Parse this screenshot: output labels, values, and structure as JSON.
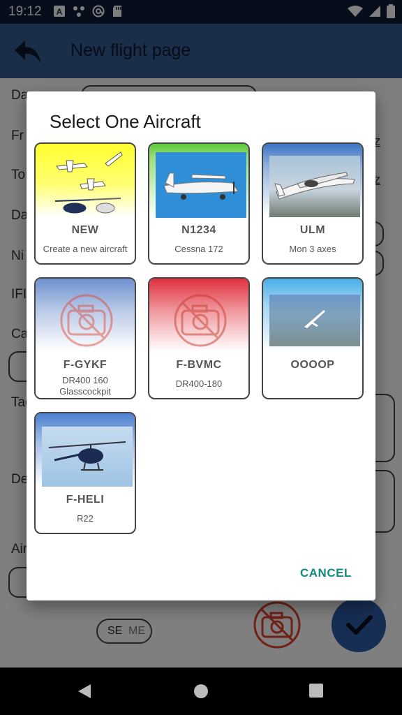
{
  "status_bar": {
    "time": "19:12"
  },
  "app_bar": {
    "title": "New flight page"
  },
  "background_form": {
    "labels": [
      "Da",
      "Fr",
      "To",
      "Da",
      "Ni",
      "IFI",
      "Cap",
      "Tag",
      "De",
      "Air"
    ],
    "link_suffix_1": "z",
    "link_suffix_2": "z",
    "switch_on": "SE",
    "switch_off": "ME"
  },
  "dialog": {
    "title": "Select One Aircraft",
    "cancel_label": "CANCEL",
    "aircraft": [
      {
        "name": "NEW",
        "model": "Create a new aircraft",
        "image": "new-aircraft-collage"
      },
      {
        "name": "N1234",
        "model": "Cessna 172",
        "image": "cessna-photo"
      },
      {
        "name": "ULM",
        "model": "Mon 3 axes",
        "image": "ulm-photo"
      },
      {
        "name": "F-GYKF",
        "model": "DR400 160 Glasscockpit",
        "image": "no-photo-icon"
      },
      {
        "name": "F-BVMC",
        "model": "DR400-180",
        "image": "no-photo-icon"
      },
      {
        "name": "OOOOP",
        "model": "",
        "image": "glider-photo"
      },
      {
        "name": "F-HELI",
        "model": "R22",
        "image": "helicopter-photo"
      }
    ]
  },
  "colors": {
    "status_bar": "#0d1b36",
    "app_bar": "#355a92",
    "accent": "#128a7d",
    "fab": "#2f5da8",
    "no_photo_icon": "#e0402a"
  }
}
